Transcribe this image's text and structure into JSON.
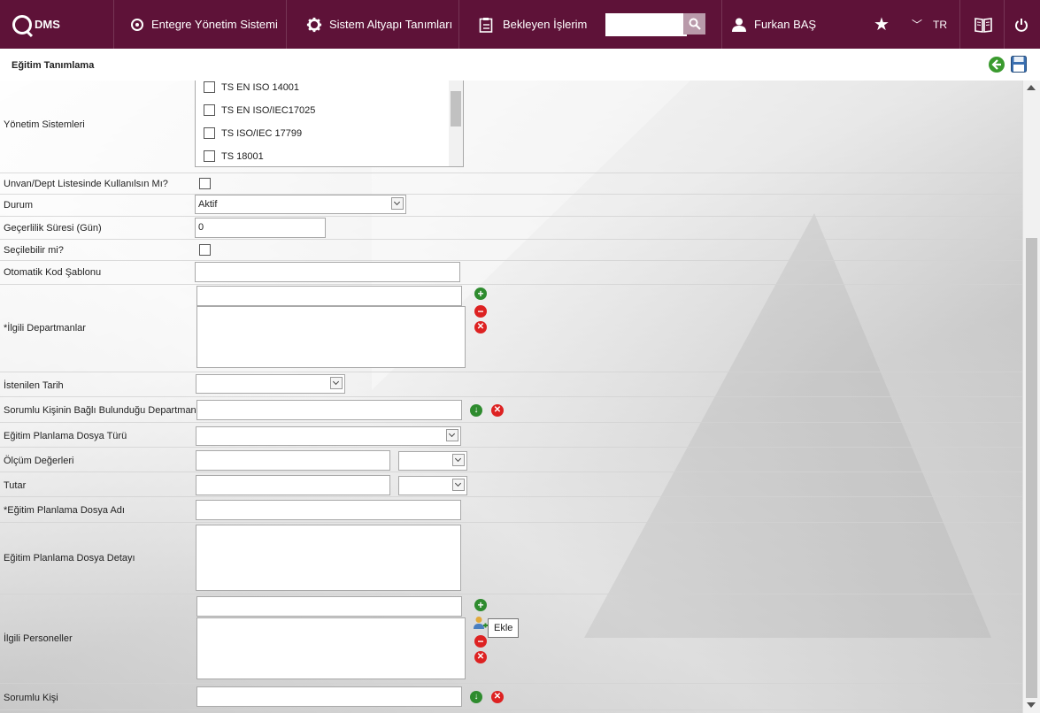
{
  "topbar": {
    "logo_text": "DMS",
    "nav1": "Entegre Yönetim Sistemi",
    "nav2": "Sistem Altyapı Tanımları",
    "nav3": "Bekleyen İşlerim",
    "search_value": "",
    "user": "Furkan BAŞ",
    "lang": "TR"
  },
  "page": {
    "title": "Eğitim Tanımlama"
  },
  "form": {
    "yonetim_label": "Yönetim Sistemleri",
    "yonetim_items": [
      "TS EN ISO 14001",
      "TS EN ISO/IEC17025",
      "TS ISO/IEC 17799",
      "TS 18001"
    ],
    "unvan_label": "Unvan/Dept Listesinde Kullanılsın Mı?",
    "durum_label": "Durum",
    "durum_value": "Aktif",
    "gecerlilik_label": "Geçerlilik Süresi (Gün)",
    "gecerlilik_value": "0",
    "secilebilir_label": "Seçilebilir mi?",
    "otomatik_label": "Otomatik Kod Şablonu",
    "ilgili_dept_label": "*İlgili Departmanlar",
    "istenilen_tarih_label": "İstenilen Tarih",
    "sorumlu_dept_label": "Sorumlu Kişinin Bağlı Bulunduğu Departman",
    "dosya_turu_label": "Eğitim Planlama Dosya Türü",
    "olcum_label": "Ölçüm Değerleri",
    "tutar_label": "Tutar",
    "dosya_adi_label": "*Eğitim Planlama Dosya Adı",
    "dosya_detay_label": "Eğitim Planlama Dosya Detayı",
    "ilgili_personel_label": "İlgili Personeller",
    "sorumlu_kisi_label": "Sorumlu Kişi"
  },
  "tooltip": "Ekle",
  "colors": {
    "topbar": "#5e1238",
    "add": "#2e8b2e",
    "remove": "#d22"
  }
}
